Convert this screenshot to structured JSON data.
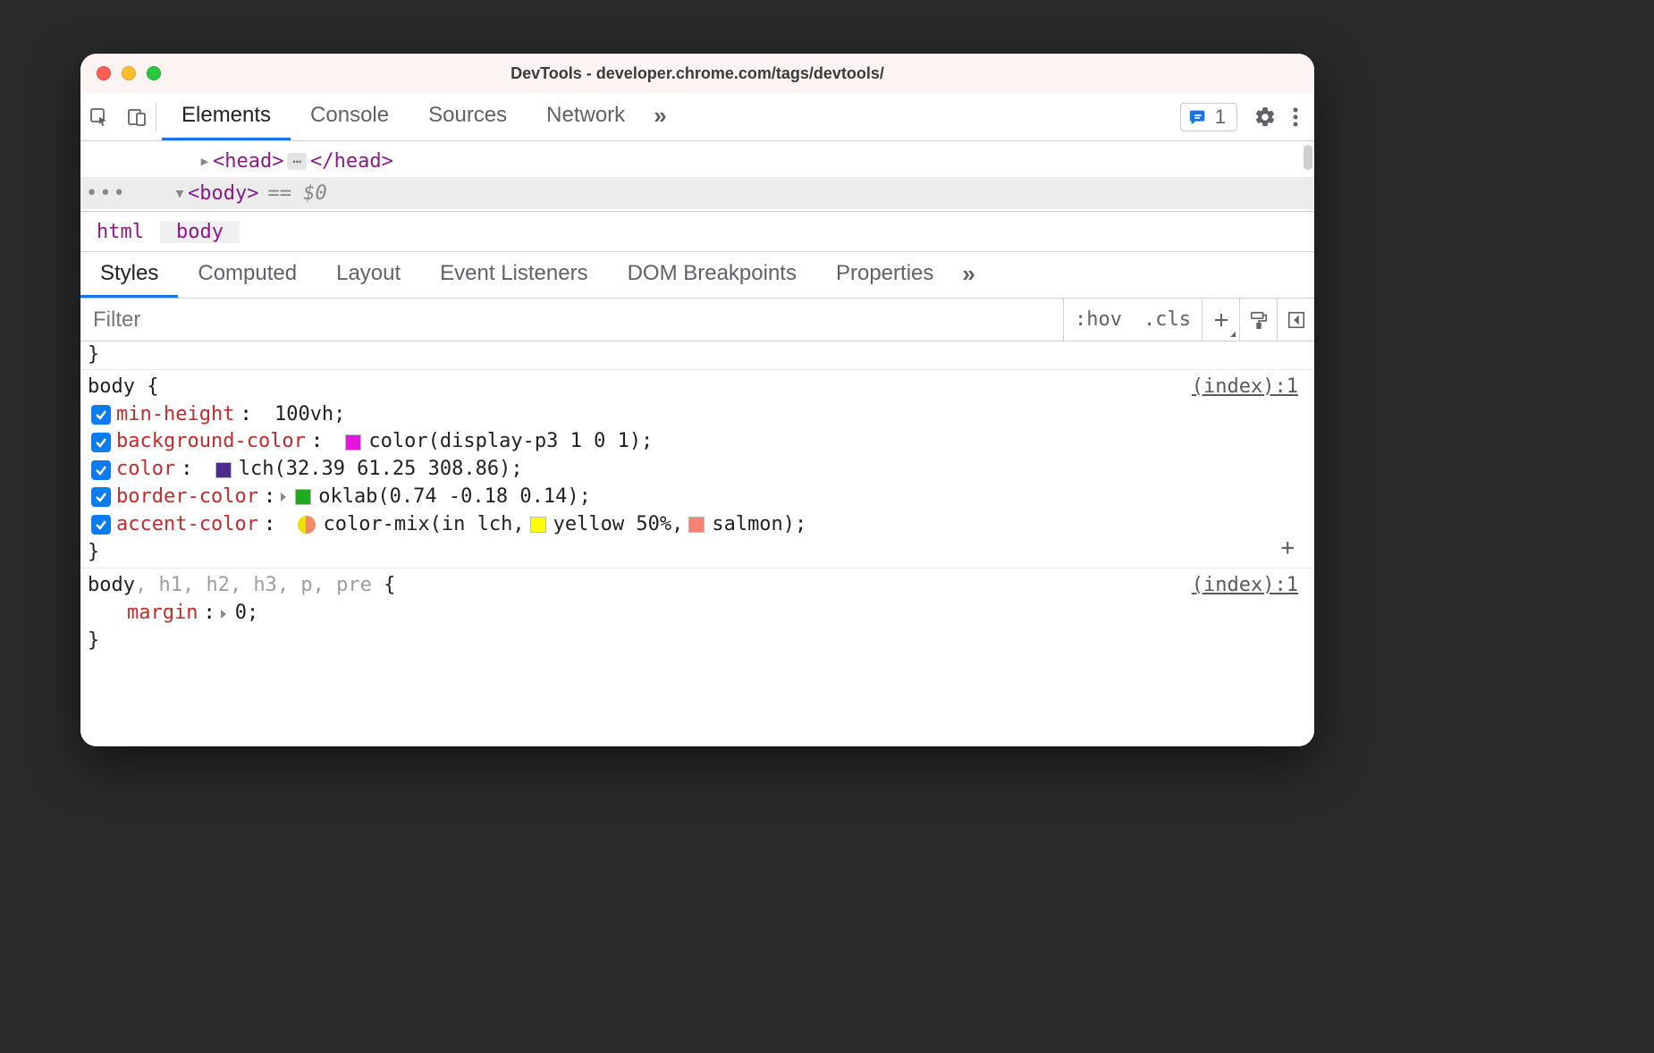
{
  "window_title": "DevTools - developer.chrome.com/tags/devtools/",
  "panel_tabs": {
    "elements": "Elements",
    "console": "Console",
    "sources": "Sources",
    "network": "Network"
  },
  "issues_count": "1",
  "dom": {
    "head_open": "<head>",
    "head_close": "</head>",
    "body_open": "<body>",
    "eq0": "== $0"
  },
  "breadcrumb": {
    "html": "html",
    "body": "body"
  },
  "sidebar_tabs": {
    "styles": "Styles",
    "computed": "Computed",
    "layout": "Layout",
    "event_listeners": "Event Listeners",
    "dom_breakpoints": "DOM Breakpoints",
    "properties": "Properties"
  },
  "styles_toolbar": {
    "filter_placeholder": "Filter",
    "hov": ":hov",
    "cls": ".cls"
  },
  "rules": {
    "rule1": {
      "selector": "body",
      "brace_open": "{",
      "brace_close": "}",
      "src": "(index):1",
      "p1": {
        "name": "min-height",
        "value": "100vh;"
      },
      "p2": {
        "name": "background-color",
        "swatch_hex": "#e315e3",
        "value": "color(display-p3 1 0 1);"
      },
      "p3": {
        "name": "color",
        "swatch_hex": "#4f2a8e",
        "value": "lch(32.39 61.25 308.86);"
      },
      "p4": {
        "name": "border-color",
        "swatch_hex": "#1faa1f",
        "value": "oklab(0.74 -0.18 0.14);"
      },
      "p5": {
        "name": "accent-color",
        "value_prefix": "color-mix(in lch, ",
        "arg1_swatch_hex": "#ffff00",
        "arg1_text": "yellow 50%, ",
        "arg2_swatch_hex": "#fa8072",
        "arg2_text": "salmon);"
      }
    },
    "rule2": {
      "selector_strong": "body",
      "selector_dim": ", h1, h2, h3, p, pre",
      "brace_open": "{",
      "brace_close": "}",
      "src": "(index):1",
      "p1": {
        "name": "margin",
        "value": "0;"
      }
    }
  }
}
